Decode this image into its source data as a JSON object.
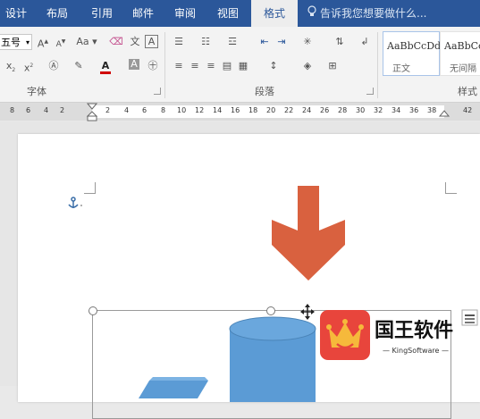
{
  "tabs": [
    {
      "label": "设计",
      "active": false
    },
    {
      "label": "布局",
      "active": false
    },
    {
      "label": "引用",
      "active": false
    },
    {
      "label": "邮件",
      "active": false
    },
    {
      "label": "审阅",
      "active": false
    },
    {
      "label": "视图",
      "active": false
    },
    {
      "label": "格式",
      "active": true
    }
  ],
  "tell_me": {
    "placeholder": "告诉我您想要做什么..."
  },
  "font_group": {
    "size_value": "五号",
    "grow_label": "A",
    "shrink_label": "A",
    "case_label": "Aa",
    "label": "字体"
  },
  "paragraph_group": {
    "label": "段落"
  },
  "styles_group": {
    "label": "样式",
    "styles": [
      {
        "sample": "AaBbCcDdI",
        "name": "正文"
      },
      {
        "sample": "AaBbCcI",
        "name": "无间隔"
      }
    ]
  },
  "ruler": {
    "ticks": [
      "8",
      "6",
      "4",
      "2",
      "2",
      "4",
      "6",
      "8",
      "10",
      "12",
      "14",
      "16",
      "18",
      "20",
      "22",
      "24",
      "26",
      "28",
      "30",
      "32",
      "34",
      "36",
      "38",
      "42"
    ]
  },
  "watermark": {
    "name": "国王软件",
    "sub": "KingSoftware"
  },
  "colors": {
    "ribbon_blue": "#2b579a",
    "arrow_orange": "#d9613f",
    "shape_blue": "#5b9bd5",
    "logo_red": "#e8453c",
    "font_color_underline": "#d00000"
  },
  "icons": [
    "anchor-icon",
    "move-cursor-icon",
    "lightbulb-icon",
    "layout-options-icon"
  ]
}
